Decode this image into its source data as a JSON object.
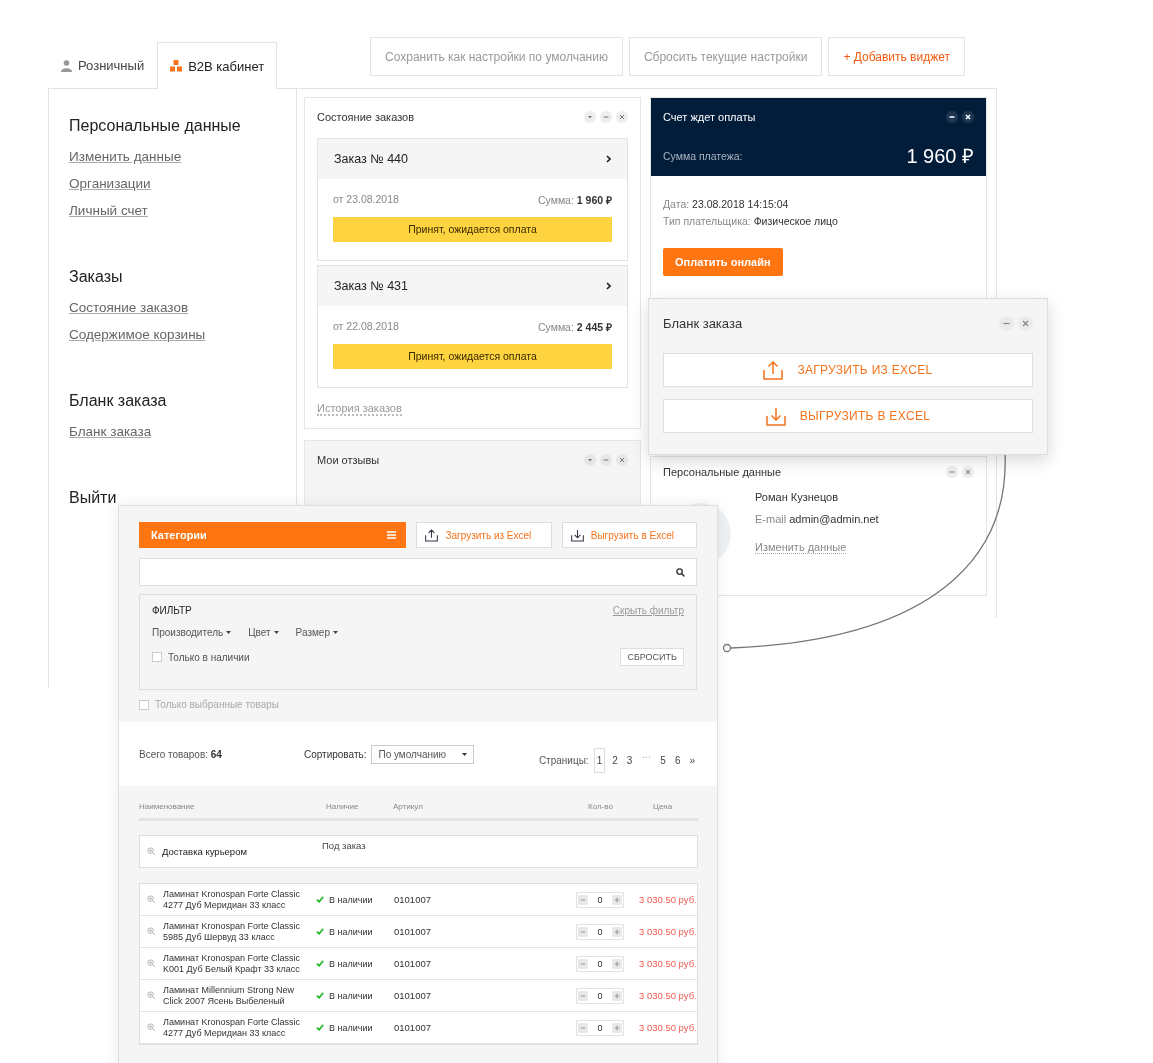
{
  "account_tabs": [
    {
      "label": "Розничный",
      "selected": false
    },
    {
      "label": "B2B кабинет",
      "selected": true
    }
  ],
  "toolbar": [
    {
      "label": "Сохранить как настройки по умолчанию",
      "kind": "plain"
    },
    {
      "label": "Сбросить текущие настройки",
      "kind": "plain"
    },
    {
      "label": "+ Добавить виджет",
      "kind": "accent"
    }
  ],
  "sidebar": [
    {
      "title": "Персональные данные",
      "links": [
        "Изменить данные",
        "Организации",
        "Личный счет"
      ]
    },
    {
      "title": "Заказы",
      "links": [
        "Состояние заказов",
        "Содержимое корзины"
      ]
    },
    {
      "title": "Бланк заказа",
      "links": [
        "Бланк заказа"
      ]
    },
    {
      "title": "Выйти"
    }
  ],
  "order_status_widget": {
    "title": "Состояние заказов",
    "orders": [
      {
        "title": "Заказ № 440",
        "date": "от 23.08.2018",
        "sum_label": "Сумма:",
        "sum": "1 960 ₽",
        "status": "Принят, ожидается оплата"
      },
      {
        "title": "Заказ № 431",
        "date": "от 22.08.2018",
        "sum_label": "Сумма:",
        "sum": "2 445 ₽",
        "status": "Принят, ожидается оплата"
      }
    ],
    "history_link": "История заказов"
  },
  "reviews_widget": {
    "title": "Мои отзывы"
  },
  "invoice_widget": {
    "title": "Счет ждет оплаты",
    "amount_label": "Сумма платежа:",
    "amount": "1 960 ₽",
    "date_label": "Дата:",
    "date": "23.08.2018 14:15:04",
    "payer_label": "Тип плательщика:",
    "payer": "Физическое лицо",
    "pay_button": "Оплатить онлайн"
  },
  "personal_widget": {
    "title": "Персональные данные",
    "name": "Роман Кузнецов",
    "email_label": "E-mail",
    "email": "admin@admin.net",
    "edit_link": "Изменить данные"
  },
  "order_form_popup": {
    "title": "Бланк заказа",
    "buttons": [
      {
        "label": "ЗАГРУЗИТЬ ИЗ EXCEL",
        "kind": "upload"
      },
      {
        "label": "ВЫГРУЗИТЬ В EXCEL",
        "kind": "download"
      }
    ]
  },
  "catalog": {
    "categories_button": "Категории",
    "excel_buttons": [
      {
        "label": "Загрузить из Excel",
        "kind": "upload"
      },
      {
        "label": "Выгрузить в Excel",
        "kind": "download"
      }
    ],
    "filter": {
      "title": "ФИЛЬТР",
      "hide_link": "Скрыть фильтр",
      "dropdowns": [
        "Производитель",
        "Цвет",
        "Размер"
      ],
      "in_stock_only": {
        "label": "Только в наличии",
        "checked": false
      },
      "reset_button": "СБРОСИТЬ"
    },
    "selected_only": {
      "label": "Только выбранные товары",
      "checked": false
    },
    "total_label": "Всего товаров:",
    "total": "64",
    "sort_label": "Сортировать:",
    "sort_value": "По умолчанию",
    "pages_label": "Страницы:",
    "pages": [
      {
        "label": "1",
        "kind": "page",
        "selected": true
      },
      {
        "label": "2",
        "kind": "page",
        "selected": false
      },
      {
        "label": "3",
        "kind": "page",
        "selected": false
      },
      {
        "label": "…",
        "kind": "gap",
        "selected": false
      },
      {
        "label": "5",
        "kind": "page",
        "selected": false
      },
      {
        "label": "6",
        "kind": "page",
        "selected": false
      }
    ],
    "next_page": "»",
    "table": {
      "columns": [
        "Наименование",
        "Наличие",
        "Артикул",
        "Кол-во",
        "Цена"
      ],
      "service_row": {
        "name": "Доставка курьером",
        "availability": "Под заказ"
      },
      "rows": [
        {
          "name": "Ламинат Kronospan Forte Classic 4277 Дуб Меридиан 33 класс",
          "in_stock": true,
          "availability": "В наличии",
          "sku": "0101007",
          "qty": "0",
          "price": "3 030.50 руб."
        },
        {
          "name": "Ламинат Kronospan Forte Classic 5985 Дуб Шервуд 33 класс",
          "in_stock": true,
          "availability": "В наличии",
          "sku": "0101007",
          "qty": "0",
          "price": "3 030.50 руб."
        },
        {
          "name": "Ламинат Kronospan Forte Classic K001 Дуб Белый Крафт 33 класс",
          "in_stock": true,
          "availability": "В наличии",
          "sku": "0101007",
          "qty": "0",
          "price": "3 030.50 руб."
        },
        {
          "name": "Ламинат Millennium Strong New Click 2007 Ясень Выбеленый",
          "in_stock": true,
          "availability": "В наличии",
          "sku": "0101007",
          "qty": "0",
          "price": "3 030.50 руб."
        },
        {
          "name": "Ламинат Kronospan Forte Classic 4277 Дуб Меридиан 33 класс",
          "in_stock": true,
          "availability": "В наличии",
          "sku": "0101007",
          "qty": "0",
          "price": "3 030.50 руб."
        }
      ]
    }
  }
}
